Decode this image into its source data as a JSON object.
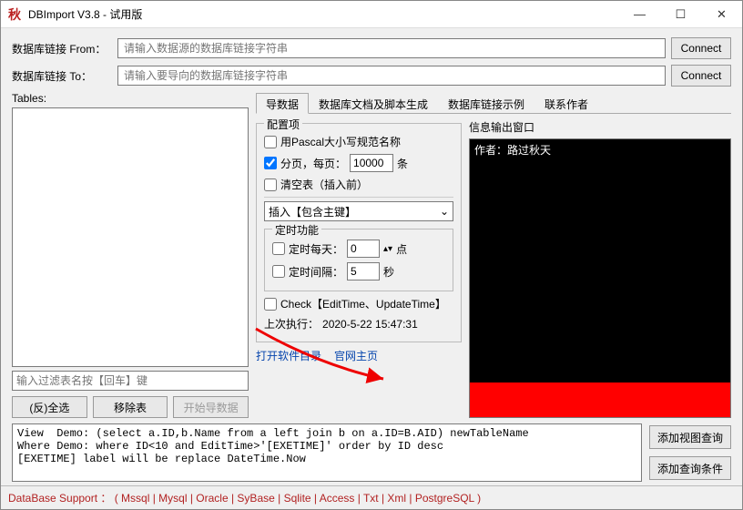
{
  "titlebar": {
    "icon": "秋",
    "title": "DBImport V3.8 - 试用版"
  },
  "winbtns": {
    "min": "—",
    "max": "☐",
    "close": "✕"
  },
  "conn": {
    "from_label": "数据库链接 From：",
    "to_label": "数据库链接 To：",
    "from_placeholder": "请输入数据源的数据库链接字符串",
    "to_placeholder": "请输入要导向的数据库链接字符串",
    "connect": "Connect"
  },
  "tables": {
    "label": "Tables:",
    "filter_placeholder": "输入过滤表名按【回车】键",
    "select_all": "(反)全选",
    "remove": "移除表",
    "start": "开始导数据"
  },
  "tabs": [
    "导数据",
    "数据库文档及脚本生成",
    "数据库链接示例",
    "联系作者"
  ],
  "config": {
    "group": "配置项",
    "pascal": "用Pascal大小写规范名称",
    "page_label": "分页，每页：",
    "page_value": "10000",
    "page_unit": "条",
    "clear": "清空表（插入前）",
    "insert_combo": "插入【包含主键】",
    "timer_group": "定时功能",
    "daily": "定时每天：",
    "daily_value": "0",
    "daily_unit": "点",
    "interval": "定时间隔：",
    "interval_value": "5",
    "interval_unit": "秒",
    "check": "Check【EditTime、UpdateTime】",
    "last_exec_label": "上次执行：",
    "last_exec_value": "2020-5-22 15:47:31",
    "link_dir": "打开软件目录",
    "link_home": "官网主页"
  },
  "output": {
    "title": "信息输出窗口",
    "author": "作者：路过秋天"
  },
  "demo": {
    "line1": "View  Demo: (select a.ID,b.Name from a left join b on a.ID=B.AID) newTableName",
    "line2": "Where Demo: where ID<10 and EditTime>'[EXETIME]' order by ID desc",
    "line3": "[EXETIME] label will be replace DateTime.Now"
  },
  "side": {
    "view": "添加视图查询",
    "cond": "添加查询条件"
  },
  "status": "DataBase Support ： ( Mssql | Mysql | Oracle | SyBase | Sqlite | Access | Txt | Xml | PostgreSQL )"
}
